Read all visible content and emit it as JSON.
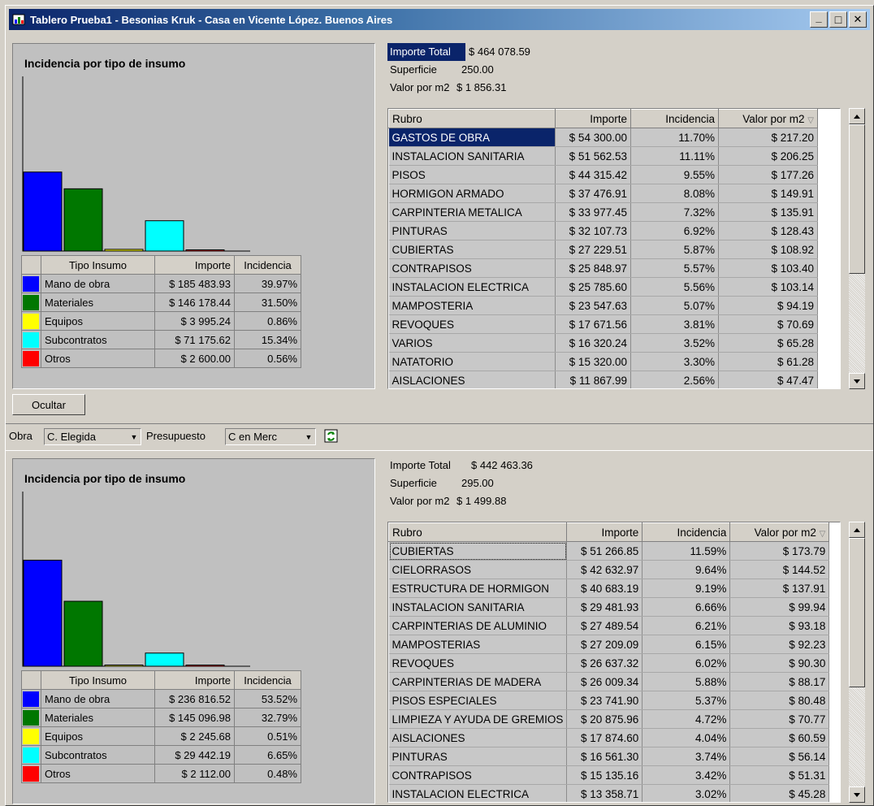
{
  "window": {
    "title": "Tablero Prueba1 - Besonias Kruk - Casa en Vicente López. Buenos Aires",
    "minimize_glyph": "_",
    "maximize_glyph": "□",
    "close_glyph": "✕"
  },
  "colors": {
    "mano_de_obra": "#0000ff",
    "materiales": "#007700",
    "equipos": "#ffff00",
    "subcontratos": "#00ffff",
    "otros": "#ff0000",
    "selection": "#0a246a"
  },
  "legend_headers": {
    "tipo": "Tipo Insumo",
    "importe": "Importe",
    "incidencia": "Incidencia"
  },
  "grid_headers": {
    "rubro": "Rubro",
    "importe": "Importe",
    "incidencia": "Incidencia",
    "valor": "Valor por m2"
  },
  "summary_labels": {
    "total": "Importe Total",
    "superficie": "Superficie",
    "valor": "Valor por m2"
  },
  "top": {
    "chart_title": "Incidencia por tipo de insumo",
    "importe_total": "$ 464 078.59",
    "superficie": "250.00",
    "valor_m2": "$ 1 856.31",
    "legend": [
      {
        "tipo": "Mano de obra",
        "importe": "$ 185 483.93",
        "incidencia": "39.97%"
      },
      {
        "tipo": "Materiales",
        "importe": "$ 146 178.44",
        "incidencia": "31.50%"
      },
      {
        "tipo": "Equipos",
        "importe": "$ 3 995.24",
        "incidencia": "0.86%"
      },
      {
        "tipo": "Subcontratos",
        "importe": "$ 71 175.62",
        "incidencia": "15.34%"
      },
      {
        "tipo": "Otros",
        "importe": "$ 2 600.00",
        "incidencia": "0.56%"
      }
    ],
    "rows": [
      {
        "rubro": "GASTOS DE OBRA",
        "importe": "$ 54 300.00",
        "incidencia": "11.70%",
        "valor": "$ 217.20"
      },
      {
        "rubro": "INSTALACION SANITARIA",
        "importe": "$ 51 562.53",
        "incidencia": "11.11%",
        "valor": "$ 206.25"
      },
      {
        "rubro": "PISOS",
        "importe": "$ 44 315.42",
        "incidencia": "9.55%",
        "valor": "$ 177.26"
      },
      {
        "rubro": "HORMIGON ARMADO",
        "importe": "$ 37 476.91",
        "incidencia": "8.08%",
        "valor": "$ 149.91"
      },
      {
        "rubro": "CARPINTERIA METALICA",
        "importe": "$ 33 977.45",
        "incidencia": "7.32%",
        "valor": "$ 135.91"
      },
      {
        "rubro": "PINTURAS",
        "importe": "$ 32 107.73",
        "incidencia": "6.92%",
        "valor": "$ 128.43"
      },
      {
        "rubro": "CUBIERTAS",
        "importe": "$ 27 229.51",
        "incidencia": "5.87%",
        "valor": "$ 108.92"
      },
      {
        "rubro": "CONTRAPISOS",
        "importe": "$ 25 848.97",
        "incidencia": "5.57%",
        "valor": "$ 103.40"
      },
      {
        "rubro": "INSTALACION ELECTRICA",
        "importe": "$ 25 785.60",
        "incidencia": "5.56%",
        "valor": "$ 103.14"
      },
      {
        "rubro": "MAMPOSTERIA",
        "importe": "$ 23 547.63",
        "incidencia": "5.07%",
        "valor": "$ 94.19"
      },
      {
        "rubro": "REVOQUES",
        "importe": "$ 17 671.56",
        "incidencia": "3.81%",
        "valor": "$ 70.69"
      },
      {
        "rubro": "VARIOS",
        "importe": "$ 16 320.24",
        "incidencia": "3.52%",
        "valor": "$ 65.28"
      },
      {
        "rubro": "NATATORIO",
        "importe": "$ 15 320.00",
        "incidencia": "3.30%",
        "valor": "$ 61.28"
      },
      {
        "rubro": "AISLACIONES",
        "importe": "$ 11 867.99",
        "incidencia": "2.56%",
        "valor": "$ 47.47"
      }
    ]
  },
  "controls": {
    "ocultar_label": "Ocultar",
    "obra_label": "Obra",
    "obra_value": "C. Elegida",
    "presupuesto_label": "Presupuesto",
    "presupuesto_value": "C en Merc",
    "refresh_icon": "refresh-icon"
  },
  "bottom": {
    "chart_title": "Incidencia por tipo de insumo",
    "importe_total": "$ 442 463.36",
    "superficie": "295.00",
    "valor_m2": "$ 1 499.88",
    "legend": [
      {
        "tipo": "Mano de obra",
        "importe": "$ 236 816.52",
        "incidencia": "53.52%"
      },
      {
        "tipo": "Materiales",
        "importe": "$ 145 096.98",
        "incidencia": "32.79%"
      },
      {
        "tipo": "Equipos",
        "importe": "$ 2 245.68",
        "incidencia": "0.51%"
      },
      {
        "tipo": "Subcontratos",
        "importe": "$ 29 442.19",
        "incidencia": "6.65%"
      },
      {
        "tipo": "Otros",
        "importe": "$ 2 112.00",
        "incidencia": "0.48%"
      }
    ],
    "rows": [
      {
        "rubro": "CUBIERTAS",
        "importe": "$ 51 266.85",
        "incidencia": "11.59%",
        "valor": "$ 173.79"
      },
      {
        "rubro": "CIELORRASOS",
        "importe": "$ 42 632.97",
        "incidencia": "9.64%",
        "valor": "$ 144.52"
      },
      {
        "rubro": "ESTRUCTURA DE HORMIGON",
        "importe": "$ 40 683.19",
        "incidencia": "9.19%",
        "valor": "$ 137.91"
      },
      {
        "rubro": "INSTALACION SANITARIA",
        "importe": "$ 29 481.93",
        "incidencia": "6.66%",
        "valor": "$ 99.94"
      },
      {
        "rubro": "CARPINTERIAS DE ALUMINIO",
        "importe": "$ 27 489.54",
        "incidencia": "6.21%",
        "valor": "$ 93.18"
      },
      {
        "rubro": "MAMPOSTERIAS",
        "importe": "$ 27 209.09",
        "incidencia": "6.15%",
        "valor": "$ 92.23"
      },
      {
        "rubro": "REVOQUES",
        "importe": "$ 26 637.32",
        "incidencia": "6.02%",
        "valor": "$ 90.30"
      },
      {
        "rubro": "CARPINTERIAS DE MADERA",
        "importe": "$ 26 009.34",
        "incidencia": "5.88%",
        "valor": "$ 88.17"
      },
      {
        "rubro": "PISOS ESPECIALES",
        "importe": "$ 23 741.90",
        "incidencia": "5.37%",
        "valor": "$ 80.48"
      },
      {
        "rubro": "LIMPIEZA Y AYUDA DE GREMIOS",
        "importe": "$ 20 875.96",
        "incidencia": "4.72%",
        "valor": "$ 70.77"
      },
      {
        "rubro": "AISLACIONES",
        "importe": "$ 17 874.60",
        "incidencia": "4.04%",
        "valor": "$ 60.59"
      },
      {
        "rubro": "PINTURAS",
        "importe": "$ 16 561.30",
        "incidencia": "3.74%",
        "valor": "$ 56.14"
      },
      {
        "rubro": "CONTRAPISOS",
        "importe": "$ 15 135.16",
        "incidencia": "3.42%",
        "valor": "$ 51.31"
      },
      {
        "rubro": "INSTALACION ELECTRICA",
        "importe": "$ 13 358.71",
        "incidencia": "3.02%",
        "valor": "$ 45.28"
      }
    ]
  },
  "chart_data": [
    {
      "type": "bar",
      "title": "Incidencia por tipo de insumo",
      "categories": [
        "Mano de obra",
        "Materiales",
        "Equipos",
        "Subcontratos",
        "Otros"
      ],
      "values": [
        185483.93,
        146178.44,
        3995.24,
        71175.62,
        2600.0
      ],
      "ylim": [
        0,
        410000
      ],
      "grid": false,
      "legend": "table-below"
    },
    {
      "type": "bar",
      "title": "Incidencia por tipo de insumo",
      "categories": [
        "Mano de obra",
        "Materiales",
        "Equipos",
        "Subcontratos",
        "Otros"
      ],
      "values": [
        236816.52,
        145096.98,
        2245.68,
        29442.19,
        2112.0
      ],
      "ylim": [
        0,
        390000
      ],
      "grid": false,
      "legend": "table-below"
    }
  ]
}
